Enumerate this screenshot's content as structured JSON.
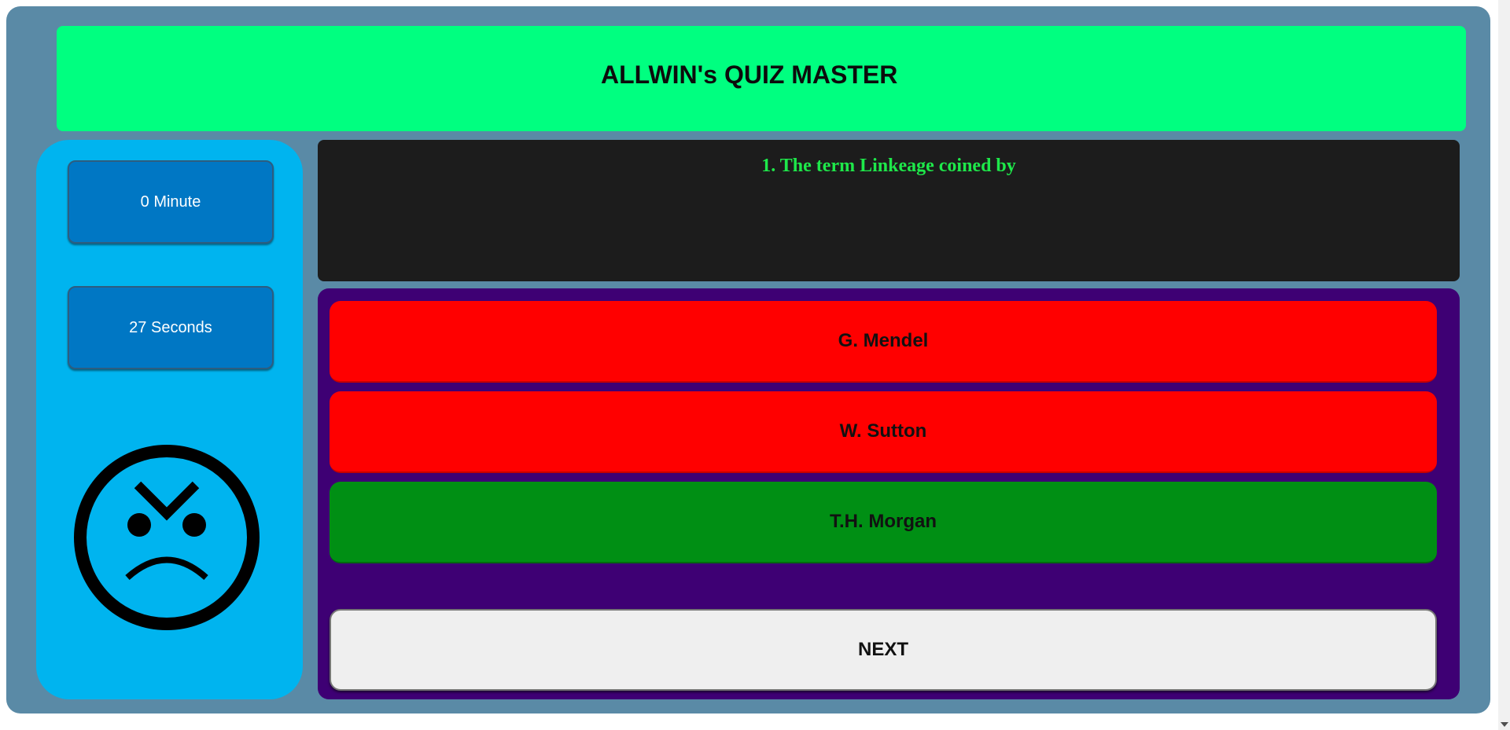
{
  "header": {
    "title": "ALLWIN's QUIZ MASTER"
  },
  "timer": {
    "minutes": "0 Minute",
    "seconds": "27 Seconds"
  },
  "status_icon": "sad-face-icon",
  "question": {
    "text": "1. The term Linkeage coined by"
  },
  "options": [
    {
      "label": "G. Mendel",
      "state": "wrong"
    },
    {
      "label": "W. Sutton",
      "state": "wrong"
    },
    {
      "label": "T.H. Morgan",
      "state": "correct"
    }
  ],
  "next_label": "NEXT",
  "colors": {
    "background": "#5a8aa6",
    "header": "#00ff80",
    "sidebar": "#00b4ef",
    "timer": "#0077c4",
    "question_bg": "#1c1c1c",
    "question_text": "#1ee84a",
    "answers_bg": "#3e0074",
    "wrong": "#ff0000",
    "correct": "#008f14",
    "next_button": "#efefef"
  }
}
